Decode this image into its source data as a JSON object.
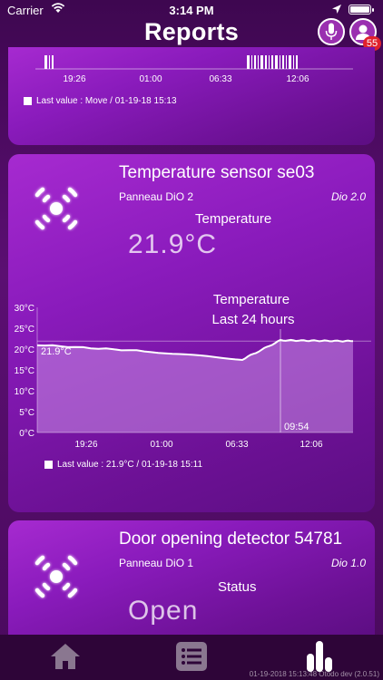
{
  "status_bar": {
    "carrier": "Carrier",
    "time": "3:14 PM"
  },
  "header": {
    "title": "Reports",
    "badge_count": "55"
  },
  "card_move": {
    "x_ticks": [
      "19:26",
      "01:00",
      "06:33",
      "12:06"
    ],
    "legend": "Last value : Move / 01-19-18 15:13"
  },
  "card_temperature": {
    "title": "Temperature sensor se03",
    "panel": "Panneau DiO 2",
    "version": "Dio 2.0",
    "sensor_label": "Temperature",
    "value": "21.9°C",
    "chart_title_line1": "Temperature",
    "chart_title_line2": "Last 24 hours",
    "point_label": "21.9°C",
    "cursor_label": "09:54",
    "legend": "Last value : 21.9°C / 01-19-18 15:11"
  },
  "card_door": {
    "title": "Door opening detector 54781",
    "panel": "Panneau DiO 1",
    "version": "Dio 1.0",
    "sensor_label": "Status",
    "value": "Open"
  },
  "footer": {
    "note": "01-19-2018 15:13:48 Otodo dev (2.0.51)"
  },
  "colors": {
    "accent": "#9a2fb0",
    "badge": "#e0212c",
    "card_top": "#a62ad0",
    "card_bottom": "#5c0e82"
  },
  "chart_data": {
    "type": "area",
    "title": "Temperature",
    "subtitle": "Last 24 hours",
    "x": [
      "19:26",
      "01:00",
      "06:33",
      "09:54",
      "12:06",
      "15:11"
    ],
    "values": [
      21.0,
      19.5,
      17.5,
      22.1,
      22.0,
      21.9
    ],
    "y_ticks": [
      "0°C",
      "5°C",
      "10°C",
      "15°C",
      "20°C",
      "25°C",
      "30°C"
    ],
    "x_ticks": [
      "19:26",
      "01:00",
      "06:33",
      "12:06"
    ],
    "ylim": [
      0,
      30
    ],
    "grid": false,
    "legend": "bottom-left"
  }
}
